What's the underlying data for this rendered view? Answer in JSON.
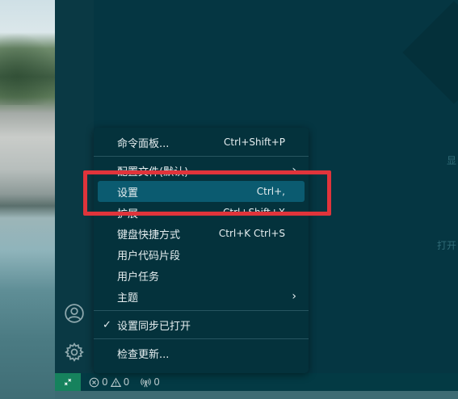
{
  "menu": {
    "items": [
      {
        "label": "命令面板...",
        "shortcut": "Ctrl+Shift+P"
      },
      {
        "label": "配置文件(默认)",
        "submenu": true
      },
      {
        "label": "设置",
        "shortcut": "Ctrl+,",
        "active": true
      },
      {
        "label": "扩展",
        "shortcut": "Ctrl+Shift+X"
      },
      {
        "label": "键盘快捷方式",
        "shortcut": "Ctrl+K Ctrl+S"
      },
      {
        "label": "用户代码片段"
      },
      {
        "label": "用户任务"
      },
      {
        "label": "主题",
        "submenu": true
      },
      {
        "label": "设置同步已打开",
        "checked": true
      },
      {
        "label": "检查更新..."
      }
    ],
    "submenu_arrow": "›",
    "check_mark": "✓"
  },
  "status_bar": {
    "errors": "0",
    "warnings": "0",
    "ports": "0"
  },
  "editor": {
    "side_hint_1": "显",
    "side_hint_2": "打开"
  },
  "icons": {
    "account": "account-icon",
    "settings": "gear-icon",
    "remote": "remote-icon",
    "error": "error-icon",
    "warning": "warning-icon",
    "ports": "broadcast-icon"
  },
  "colors": {
    "accent_highlight": "#e0343b",
    "menu_active": "#0b5b70",
    "remote_button": "#16825d"
  }
}
